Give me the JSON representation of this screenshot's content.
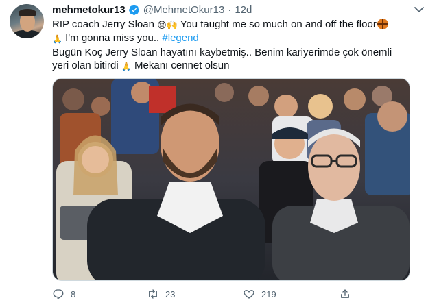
{
  "tweet": {
    "author_name": "mehmetokur13",
    "author_handle": "@MehmetOkur13",
    "separator": "·",
    "timestamp": "12d",
    "text": {
      "l1_a": "RIP coach Jerry Sloan ",
      "l1_emoji": "😔🙌",
      "l1_b": " You taught me so much on and off the floor",
      "l2_a": " I'm gonna miss you.. ",
      "hashtag": "#legend",
      "l3": "Bugün Koç Jerry Sloan hayatını kaybetmiş.. Benim kariyerimde çok önemli",
      "l4_a": "yeri olan bitirdi ",
      "l4_b": " Mekanı cennet olsun"
    },
    "icons": {
      "verified": "verified-badge-icon",
      "more": "more-options-icon",
      "basketball": "basketball-emoji",
      "pray": "folded-hands-emoji"
    },
    "photo": {
      "description_icon": "photo-image"
    },
    "actions": {
      "reply_count": "8",
      "retweet_count": "23",
      "like_count": "219"
    }
  },
  "colors": {
    "accent": "#1d9bf0",
    "text": "#0f1419",
    "secondary": "#536471"
  }
}
